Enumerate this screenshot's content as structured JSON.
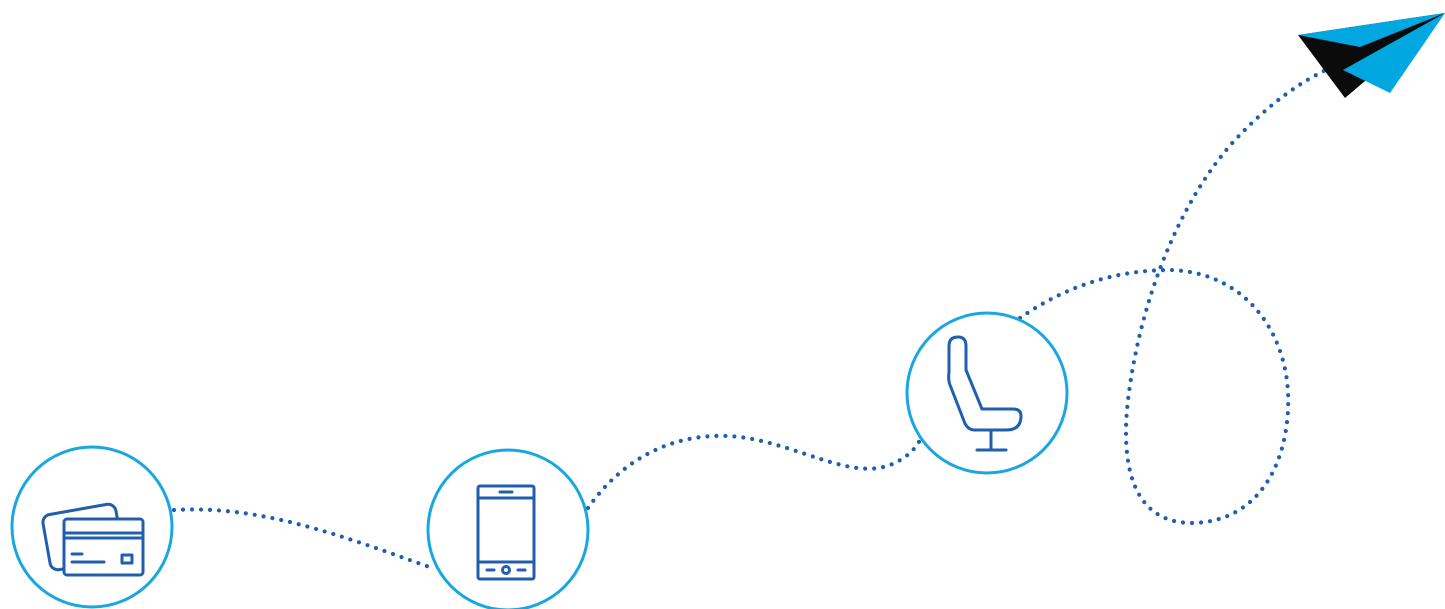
{
  "colors": {
    "background": "#ffffff",
    "path_dots": "#1f5fae",
    "circle_ring": "#1aa7e0",
    "icon_stroke": "#1f5fae",
    "plane_light": "#00a7e1",
    "plane_dark": "#0b0b0b"
  },
  "steps": [
    {
      "id": "payment",
      "icon": "credit-cards-icon"
    },
    {
      "id": "mobile",
      "icon": "smartphone-icon"
    },
    {
      "id": "seat",
      "icon": "airplane-seat-icon"
    }
  ],
  "destination": {
    "icon": "paper-plane-icon"
  }
}
